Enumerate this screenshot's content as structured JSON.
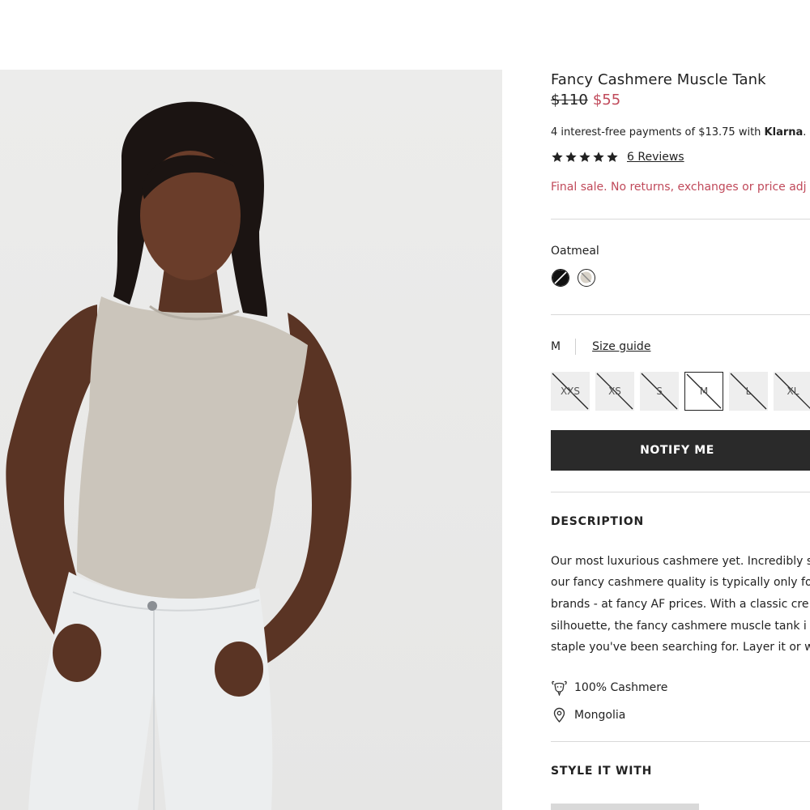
{
  "product": {
    "title": "Fancy Cashmere Muscle Tank",
    "original_price": "$110",
    "sale_price": "$55",
    "installments_text": "4 interest-free payments of $13.75 with ",
    "installments_provider": "Klarna",
    "installments_suffix": ".",
    "rating_stars": 5,
    "reviews_label": "6 Reviews",
    "final_sale_notice": "Final sale. No returns, exchanges or price adj"
  },
  "color": {
    "selected_label": "Oatmeal",
    "swatches": [
      "black-swatch",
      "oatmeal-swatch"
    ],
    "colors": {
      "black": "#111111",
      "oatmeal": "#d8d2c8"
    }
  },
  "size": {
    "selected": "M",
    "guide_label": "Size guide",
    "options": [
      "XXS",
      "XS",
      "S",
      "M",
      "L",
      "XL"
    ]
  },
  "actions": {
    "notify_label": "NOTIFY ME"
  },
  "description": {
    "heading": "DESCRIPTION",
    "lines": [
      "Our most luxurious cashmere yet. Incredibly s",
      "our fancy cashmere quality is typically only fo",
      "brands - at fancy AF prices. With a classic cre",
      "silhouette, the fancy cashmere muscle tank i",
      "staple you've been searching for. Layer it or w"
    ]
  },
  "specs": [
    {
      "icon": "goat-icon",
      "label": "100% Cashmere"
    },
    {
      "icon": "location-pin-icon",
      "label": "Mongolia"
    }
  ],
  "style_it_with": {
    "heading": "STYLE IT WITH"
  },
  "theme": {
    "accent_sale": "#c0495a",
    "button_bg": "#2a2a2a",
    "divider": "#d9d9d9"
  }
}
